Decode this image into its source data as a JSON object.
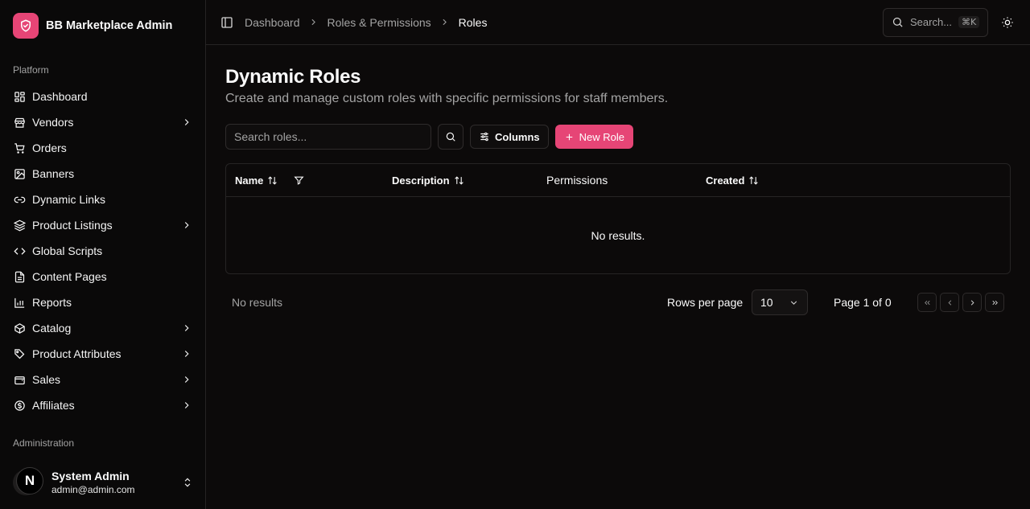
{
  "brand": {
    "name": "BB Marketplace Admin",
    "accent": "#e64576"
  },
  "sidebar": {
    "platform_label": "Platform",
    "items": [
      {
        "label": "Dashboard",
        "icon": "dashboard-icon",
        "has_children": false
      },
      {
        "label": "Vendors",
        "icon": "store-icon",
        "has_children": true
      },
      {
        "label": "Orders",
        "icon": "cart-icon",
        "has_children": false
      },
      {
        "label": "Banners",
        "icon": "image-icon",
        "has_children": false
      },
      {
        "label": "Dynamic Links",
        "icon": "link-icon",
        "has_children": false
      },
      {
        "label": "Product Listings",
        "icon": "layers-icon",
        "has_children": true
      },
      {
        "label": "Global Scripts",
        "icon": "code-icon",
        "has_children": false
      },
      {
        "label": "Content Pages",
        "icon": "file-icon",
        "has_children": false
      },
      {
        "label": "Reports",
        "icon": "bar-chart-icon",
        "has_children": false
      },
      {
        "label": "Catalog",
        "icon": "box-icon",
        "has_children": true
      },
      {
        "label": "Product Attributes",
        "icon": "tag-icon",
        "has_children": true
      },
      {
        "label": "Sales",
        "icon": "wallet-icon",
        "has_children": true
      },
      {
        "label": "Affiliates",
        "icon": "dollar-circle-icon",
        "has_children": true
      }
    ],
    "admin_label": "Administration",
    "user": {
      "name": "System Admin",
      "email": "admin@admin.com",
      "avatar_letter": "N"
    }
  },
  "header": {
    "breadcrumbs": [
      "Dashboard",
      "Roles & Permissions",
      "Roles"
    ],
    "search_label": "Search...",
    "search_shortcut": "⌘K"
  },
  "page": {
    "title": "Dynamic Roles",
    "subtitle": "Create and manage custom roles with specific permissions for staff members."
  },
  "toolbar": {
    "search_placeholder": "Search roles...",
    "columns_label": "Columns",
    "new_role_label": "New Role"
  },
  "table": {
    "columns": [
      "Name",
      "Description",
      "Permissions",
      "Created"
    ],
    "empty_message": "No results."
  },
  "footer": {
    "status": "No results",
    "rows_per_page_label": "Rows per page",
    "rows_per_page_value": "10",
    "page_info": "Page 1 of 0"
  }
}
